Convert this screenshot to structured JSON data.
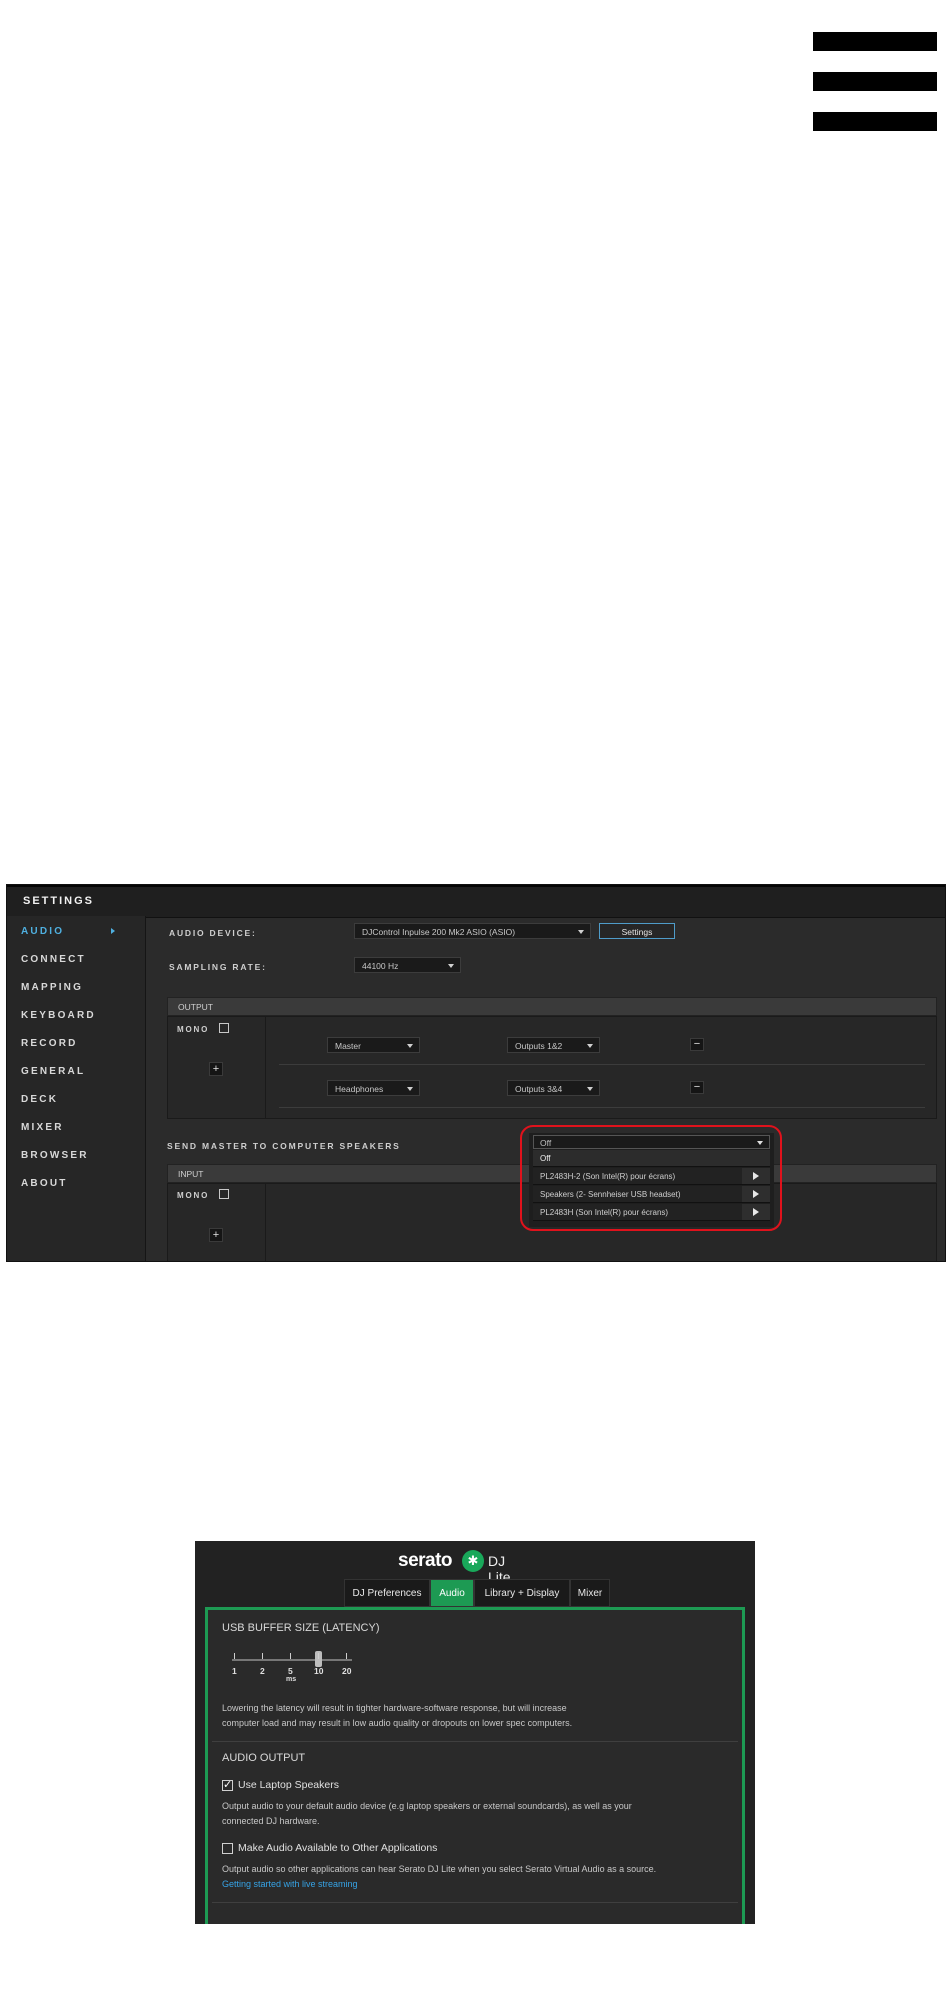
{
  "menu": {
    "icon": "hamburger-menu-icon"
  },
  "settings_panel": {
    "title": "SETTINGS",
    "sidebar": {
      "items": [
        {
          "label": "AUDIO",
          "active": true
        },
        {
          "label": "CONNECT"
        },
        {
          "label": "MAPPING"
        },
        {
          "label": "KEYBOARD"
        },
        {
          "label": "RECORD"
        },
        {
          "label": "GENERAL"
        },
        {
          "label": "DECK"
        },
        {
          "label": "MIXER"
        },
        {
          "label": "BROWSER"
        },
        {
          "label": "ABOUT"
        }
      ]
    },
    "audio_device": {
      "label": "AUDIO DEVICE:",
      "value": "DJControl Inpulse 200 Mk2 ASIO (ASIO)",
      "settings_button": "Settings"
    },
    "sampling_rate": {
      "label": "SAMPLING RATE:",
      "value": "44100 Hz"
    },
    "output": {
      "header": "OUTPUT",
      "mono_label": "MONO",
      "add_label": "+",
      "rows": [
        {
          "channel": "Master",
          "outputs": "Outputs 1&2",
          "remove_label": "−"
        },
        {
          "channel": "Headphones",
          "outputs": "Outputs 3&4",
          "remove_label": "−"
        }
      ]
    },
    "send_master": {
      "label": "SEND MASTER TO COMPUTER SPEAKERS",
      "value": "Off",
      "options": [
        "Off",
        "PL2483H-2 (Son Intel(R) pour écrans)",
        "Speakers (2- Sennheiser USB headset)",
        "PL2483H (Son Intel(R) pour écrans)"
      ],
      "highlight_color": "#e0121c"
    },
    "input": {
      "header": "INPUT",
      "mono_label": "MONO",
      "add_label": "+"
    },
    "accent_color": "#4fb0e0"
  },
  "lite_panel": {
    "brand": "serato",
    "badge_icon": "serato-logo-icon",
    "product": "DJ Lite",
    "tabs": [
      {
        "label": "DJ Preferences"
      },
      {
        "label": "Audio",
        "active": true
      },
      {
        "label": "Library + Display"
      },
      {
        "label": "Mixer"
      }
    ],
    "usb_buffer": {
      "title": "USB BUFFER SIZE (LATENCY)",
      "ticks": [
        "1",
        "2",
        "5",
        "10",
        "20"
      ],
      "unit": "ms",
      "value": 10,
      "description_1": "Lowering the latency will result in tighter hardware-software response, but will increase",
      "description_2": "computer load and may result in low audio quality or dropouts on lower spec computers."
    },
    "audio_output": {
      "title": "AUDIO OUTPUT",
      "use_laptop": {
        "label": "Use Laptop Speakers",
        "checked": true,
        "check_mark": "✓"
      },
      "use_laptop_desc_1": "Output audio to your default audio device (e.g laptop speakers or external soundcards), as well as your",
      "use_laptop_desc_2": "connected DJ hardware.",
      "make_available": {
        "label": "Make Audio Available to Other Applications",
        "checked": false
      },
      "make_available_desc": "Output audio so other applications can hear Serato DJ Lite when you select Serato Virtual Audio as a source.",
      "link": "Getting started with live streaming"
    },
    "accent_color": "#1d9a53"
  }
}
